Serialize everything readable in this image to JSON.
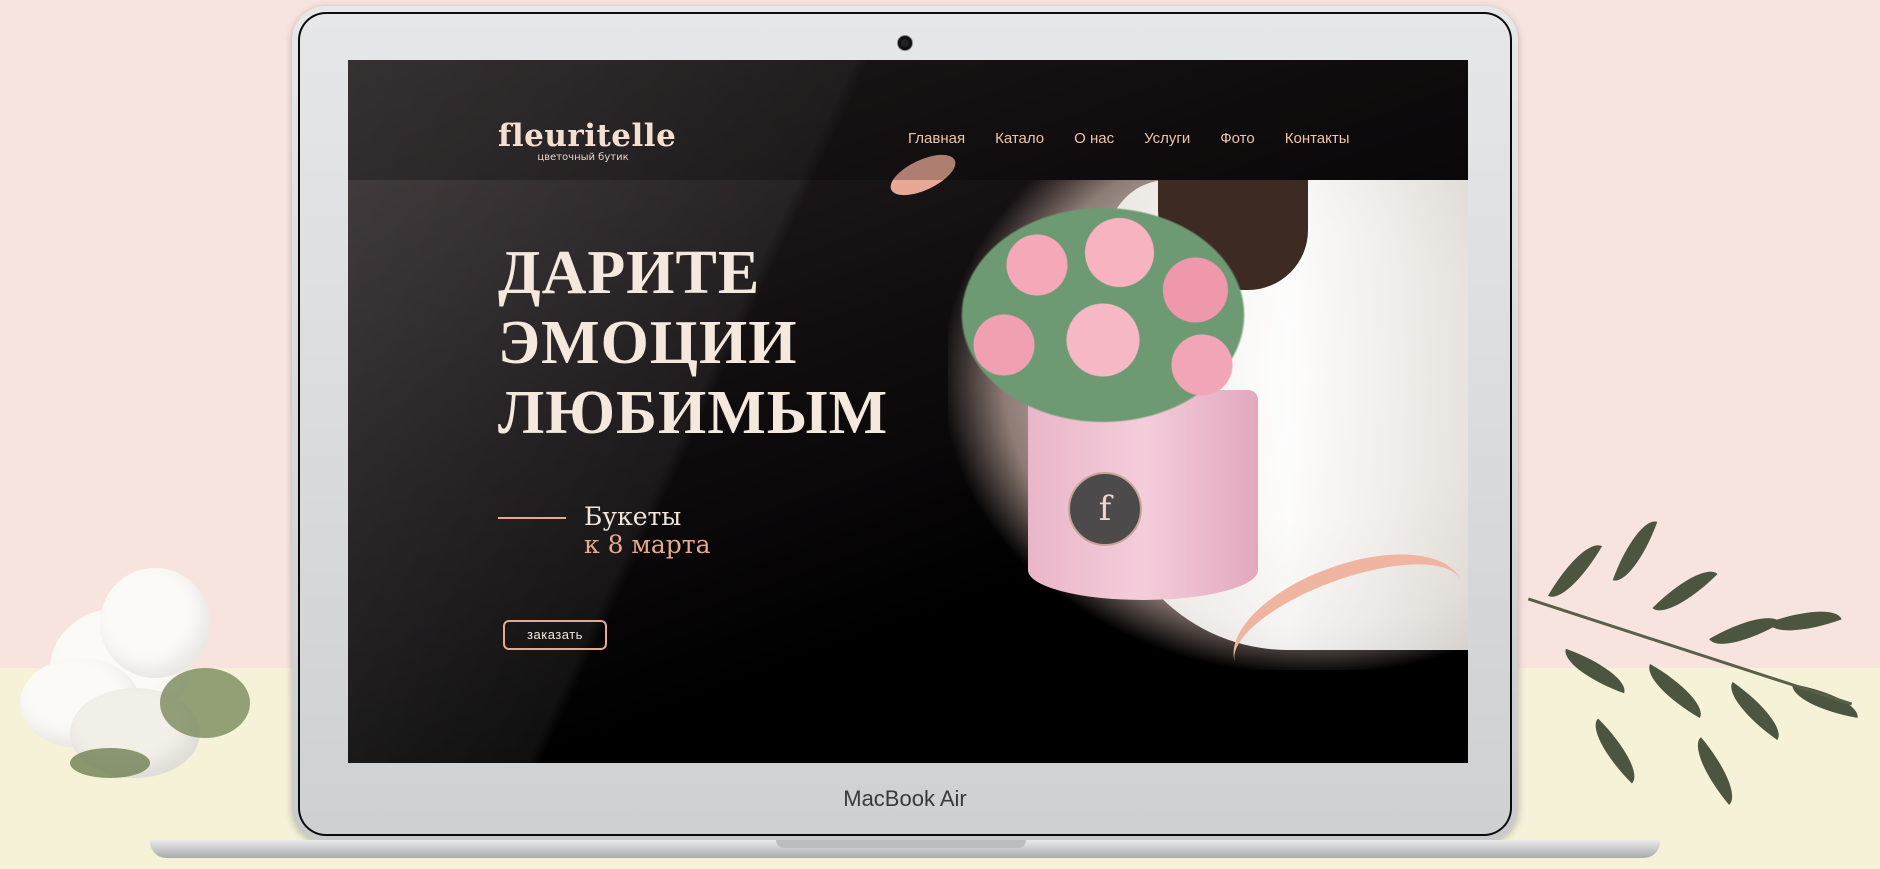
{
  "device": {
    "brand_label": "MacBook Air"
  },
  "site": {
    "logo": {
      "name": "fleuritelle",
      "tagline": "цветочный бутик"
    },
    "nav": [
      {
        "label": "Главная"
      },
      {
        "label": "Катало"
      },
      {
        "label": "О нас"
      },
      {
        "label": "Услуги"
      },
      {
        "label": "Фото"
      },
      {
        "label": "Контакты"
      }
    ],
    "hero": {
      "headline_lines": [
        "ДАРИТЕ",
        "ЭМОЦИИ",
        "ЛЮБИМЫМ"
      ],
      "subline_1": "Букеты",
      "subline_2": "к 8 марта",
      "order_button": "заказать"
    }
  },
  "colors": {
    "accent": "#e7a98e",
    "headline": "#f5e9dd",
    "screen_background": "#050505",
    "page_background_top": "#f8e4df",
    "page_background_bottom": "#f5f2d8"
  },
  "icons": [
    "camera-icon",
    "box-logo-icon"
  ]
}
